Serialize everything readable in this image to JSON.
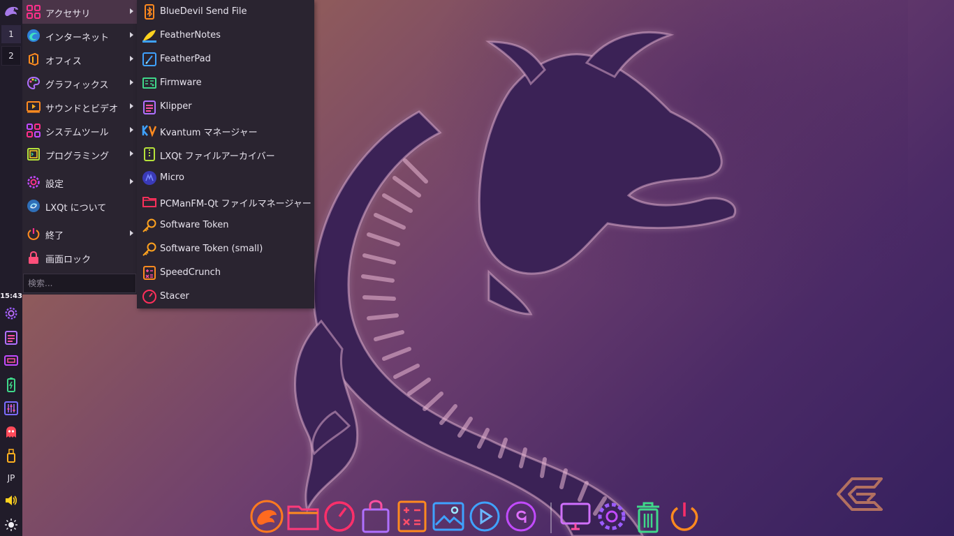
{
  "panel": {
    "desktops": [
      "1",
      "2"
    ],
    "clock": "15:43",
    "keyboard_layout": "JP"
  },
  "main_menu": {
    "items": [
      {
        "label": "アクセサリ",
        "icon": "accessories-icon",
        "submenu": true,
        "highlighted": true
      },
      {
        "label": "インターネット",
        "icon": "internet-icon",
        "submenu": true
      },
      {
        "label": "オフィス",
        "icon": "office-icon",
        "submenu": true
      },
      {
        "label": "グラフィックス",
        "icon": "graphics-icon",
        "submenu": true
      },
      {
        "label": "サウンドとビデオ",
        "icon": "multimedia-icon",
        "submenu": true
      },
      {
        "label": "システムツール",
        "icon": "system-tools-icon",
        "submenu": true
      },
      {
        "label": "プログラミング",
        "icon": "programming-icon",
        "submenu": true
      },
      {
        "label": "設定",
        "icon": "settings-icon",
        "submenu": true
      },
      {
        "label": "LXQt について",
        "icon": "lxqt-icon",
        "submenu": false
      },
      {
        "label": "終了",
        "icon": "power-icon",
        "submenu": true
      },
      {
        "label": "画面ロック",
        "icon": "lock-icon",
        "submenu": false
      }
    ],
    "search_placeholder": "検索..."
  },
  "sub_menu": {
    "items": [
      {
        "label": "BlueDevil Send File",
        "icon": "bluetooth-icon"
      },
      {
        "label": "FeatherNotes",
        "icon": "feathernotes-icon"
      },
      {
        "label": "FeatherPad",
        "icon": "featherpad-icon"
      },
      {
        "label": "Firmware",
        "icon": "firmware-icon"
      },
      {
        "label": "Klipper",
        "icon": "clipboard-icon"
      },
      {
        "label": "Kvantum マネージャー",
        "icon": "kvantum-icon"
      },
      {
        "label": "LXQt ファイルアーカイバー",
        "icon": "archive-icon"
      },
      {
        "label": "Micro",
        "icon": "micro-icon"
      },
      {
        "label": "PCManFM-Qt ファイルマネージャー",
        "icon": "folder-icon"
      },
      {
        "label": "Software Token",
        "icon": "key-icon"
      },
      {
        "label": "Software Token (small)",
        "icon": "key-icon"
      },
      {
        "label": "SpeedCrunch",
        "icon": "calculator-icon"
      },
      {
        "label": "Stacer",
        "icon": "stacer-icon"
      }
    ]
  },
  "dock": {
    "items": [
      "garuda-icon",
      "folder-icon",
      "browser-icon",
      "store-icon",
      "calculator-icon",
      "image-viewer-icon",
      "media-player-icon",
      "text-editor-icon",
      "monitor-icon",
      "settings-icon",
      "trash-icon",
      "power-icon"
    ]
  },
  "colors": {
    "panel_bg": "#211c2a",
    "menu_bg": "#2a2430",
    "highlight": "#4a3448",
    "accent_pink": "#ff2f8a",
    "accent_orange": "#ff8a1f",
    "accent_blue": "#3fa2ff",
    "accent_purple": "#9b5cff",
    "accent_green": "#3fd88a"
  }
}
